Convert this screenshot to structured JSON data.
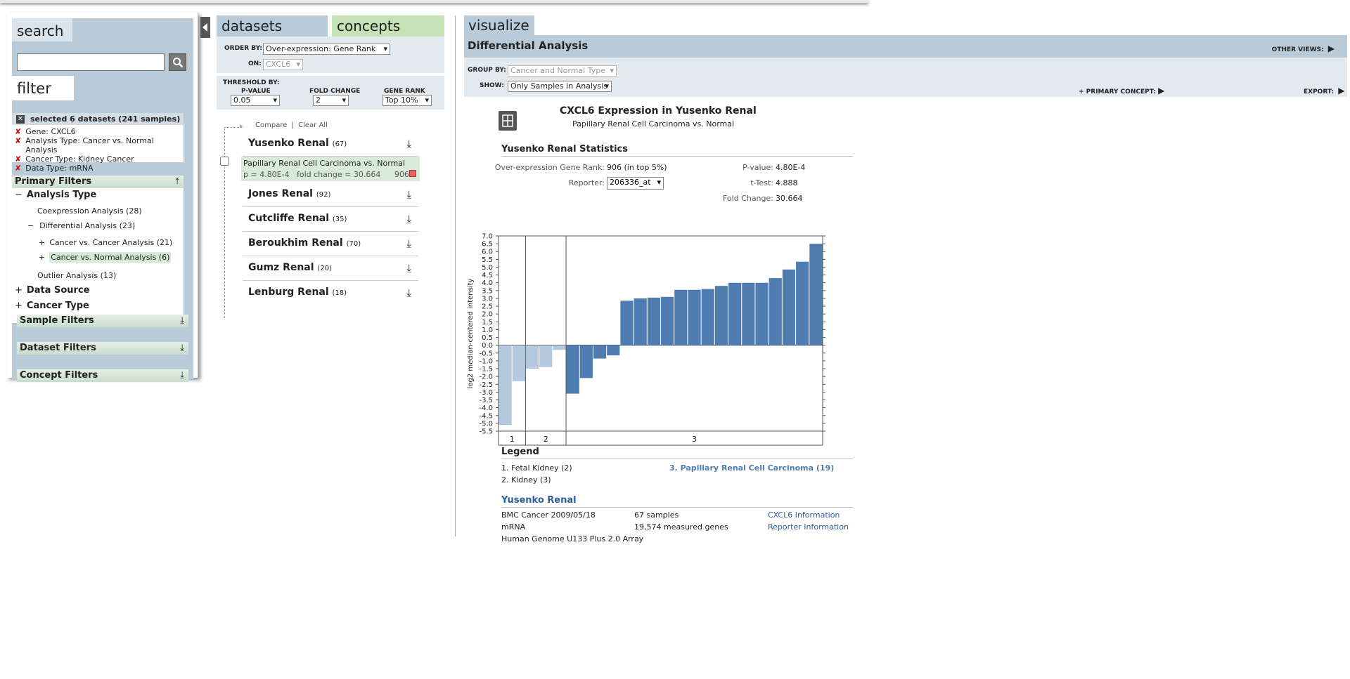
{
  "left": {
    "search_tab": "search",
    "search_placeholder": "",
    "filter_tab": "filter",
    "selected_header": "selected 6 datasets (241 samples)",
    "active_filters": [
      "Gene: CXCL6",
      "Analysis Type: Cancer vs. Normal Analysis",
      "Cancer Type: Kidney Cancer",
      "Data Type: mRNA"
    ],
    "primary_filters": "Primary Filters",
    "analysis_type": "Analysis Type",
    "coexpression": "Coexpression Analysis (28)",
    "differential": "Differential Analysis (23)",
    "cancer_vs_cancer": "Cancer vs. Cancer Analysis (21)",
    "cancer_vs_normal": "Cancer vs. Normal Analysis (6)",
    "outlier": "Outlier Analysis (13)",
    "data_source": "Data Source",
    "cancer_type": "Cancer Type",
    "sample_filters": "Sample Filters",
    "dataset_filters": "Dataset Filters",
    "concept_filters": "Concept Filters",
    "minus": "−",
    "plus": "+"
  },
  "middle": {
    "tab_datasets": "datasets",
    "tab_concepts": "concepts",
    "order_by_label": "ORDER BY:",
    "order_by_value": "Over-expression: Gene Rank",
    "on_label": "ON:",
    "on_value": "CXCL6",
    "threshold_by": "THRESHOLD BY:",
    "pvalue_label": "P-VALUE",
    "pvalue_value": "0.05",
    "fold_label": "FOLD CHANGE",
    "fold_value": "2",
    "rank_label": "GENE RANK",
    "rank_value": "Top 10%",
    "compare": "Compare",
    "clear_all": "Clear All",
    "sep": "|",
    "datasets": [
      {
        "name": "Yusenko Renal",
        "count": "(67)"
      },
      {
        "name": "Jones Renal",
        "count": "(92)"
      },
      {
        "name": "Cutcliffe Renal",
        "count": "(35)"
      },
      {
        "name": "Beroukhim Renal",
        "count": "(70)"
      },
      {
        "name": "Gumz Renal",
        "count": "(20)"
      },
      {
        "name": "Lenburg Renal",
        "count": "(18)"
      }
    ],
    "analysis_title": "Papillary Renal Cell Carcinoma vs. Normal",
    "analysis_p": "p = 4.80E-4",
    "analysis_fold": "fold change = 30.664",
    "analysis_rank": "906",
    "download_icon": "⤓"
  },
  "right": {
    "tab_visualize": "visualize",
    "title": "Differential Analysis",
    "other_views": "OTHER VIEWS:",
    "group_by_label": "GROUP BY:",
    "group_by_value": "Cancer and Normal Type",
    "show_label": "SHOW:",
    "show_value": "Only Samples in Analysis",
    "primary_concept": "+ PRIMARY CONCEPT:",
    "export": "EXPORT:",
    "chart_title": "CXCL6 Expression in Yusenko Renal",
    "chart_subtitle": "Papillary Renal Cell Carcinoma vs. Normal",
    "stats_title": "Yusenko Renal Statistics",
    "gene_rank_label": "Over-expression Gene Rank:",
    "gene_rank_value": "906 (in top 5%)",
    "reporter_label": "Reporter:",
    "reporter_value": "206336_at",
    "pvalue_label": "P-value:",
    "pvalue_value": "4.80E-4",
    "ttest_label": "t-Test:",
    "ttest_value": "4.888",
    "fold_label": "Fold Change:",
    "fold_value": "30.664",
    "legend_title": "Legend",
    "legend_items": [
      "1. Fetal Kidney (2)",
      "2. Kidney (3)",
      "3. Papillary Renal Cell Carcinoma (19)"
    ],
    "ds_title": "Yusenko Renal",
    "ds_journal": "BMC Cancer 2009/05/18",
    "ds_samples": "67 samples",
    "ds_gene_link": "CXCL6 Information",
    "ds_type": "mRNA",
    "ds_genes": "19,574 measured genes",
    "ds_reporter_link": "Reporter Information",
    "ds_platform": "Human Genome U133 Plus 2.0 Array"
  },
  "chart_data": {
    "type": "bar",
    "ylabel": "log2 median-centered intensity",
    "ylim": [
      -5.5,
      7.0
    ],
    "ticks": [
      "7.0",
      "6.5",
      "6.0",
      "5.5",
      "5.0",
      "4.5",
      "4.0",
      "3.5",
      "3.0",
      "2.5",
      "2.0",
      "1.5",
      "1.0",
      "0.5",
      "0.0",
      "-0.5",
      "-1.0",
      "-1.5",
      "-2.0",
      "-2.5",
      "-3.0",
      "-3.5",
      "-4.0",
      "-4.5",
      "-5.0",
      "-5.5"
    ],
    "groups": [
      {
        "label": "1",
        "color": "#b5c9de",
        "values": [
          -5.1,
          -2.3
        ]
      },
      {
        "label": "2",
        "color": "#b5c9de",
        "values": [
          -1.5,
          -1.4,
          -0.3
        ]
      },
      {
        "label": "3",
        "color": "#4f7db2",
        "values": [
          -3.1,
          -2.1,
          -0.85,
          -0.65,
          2.85,
          3.0,
          3.05,
          3.1,
          3.55,
          3.55,
          3.6,
          3.8,
          4.0,
          4.0,
          4.0,
          4.3,
          4.85,
          5.35,
          6.5
        ]
      }
    ]
  }
}
